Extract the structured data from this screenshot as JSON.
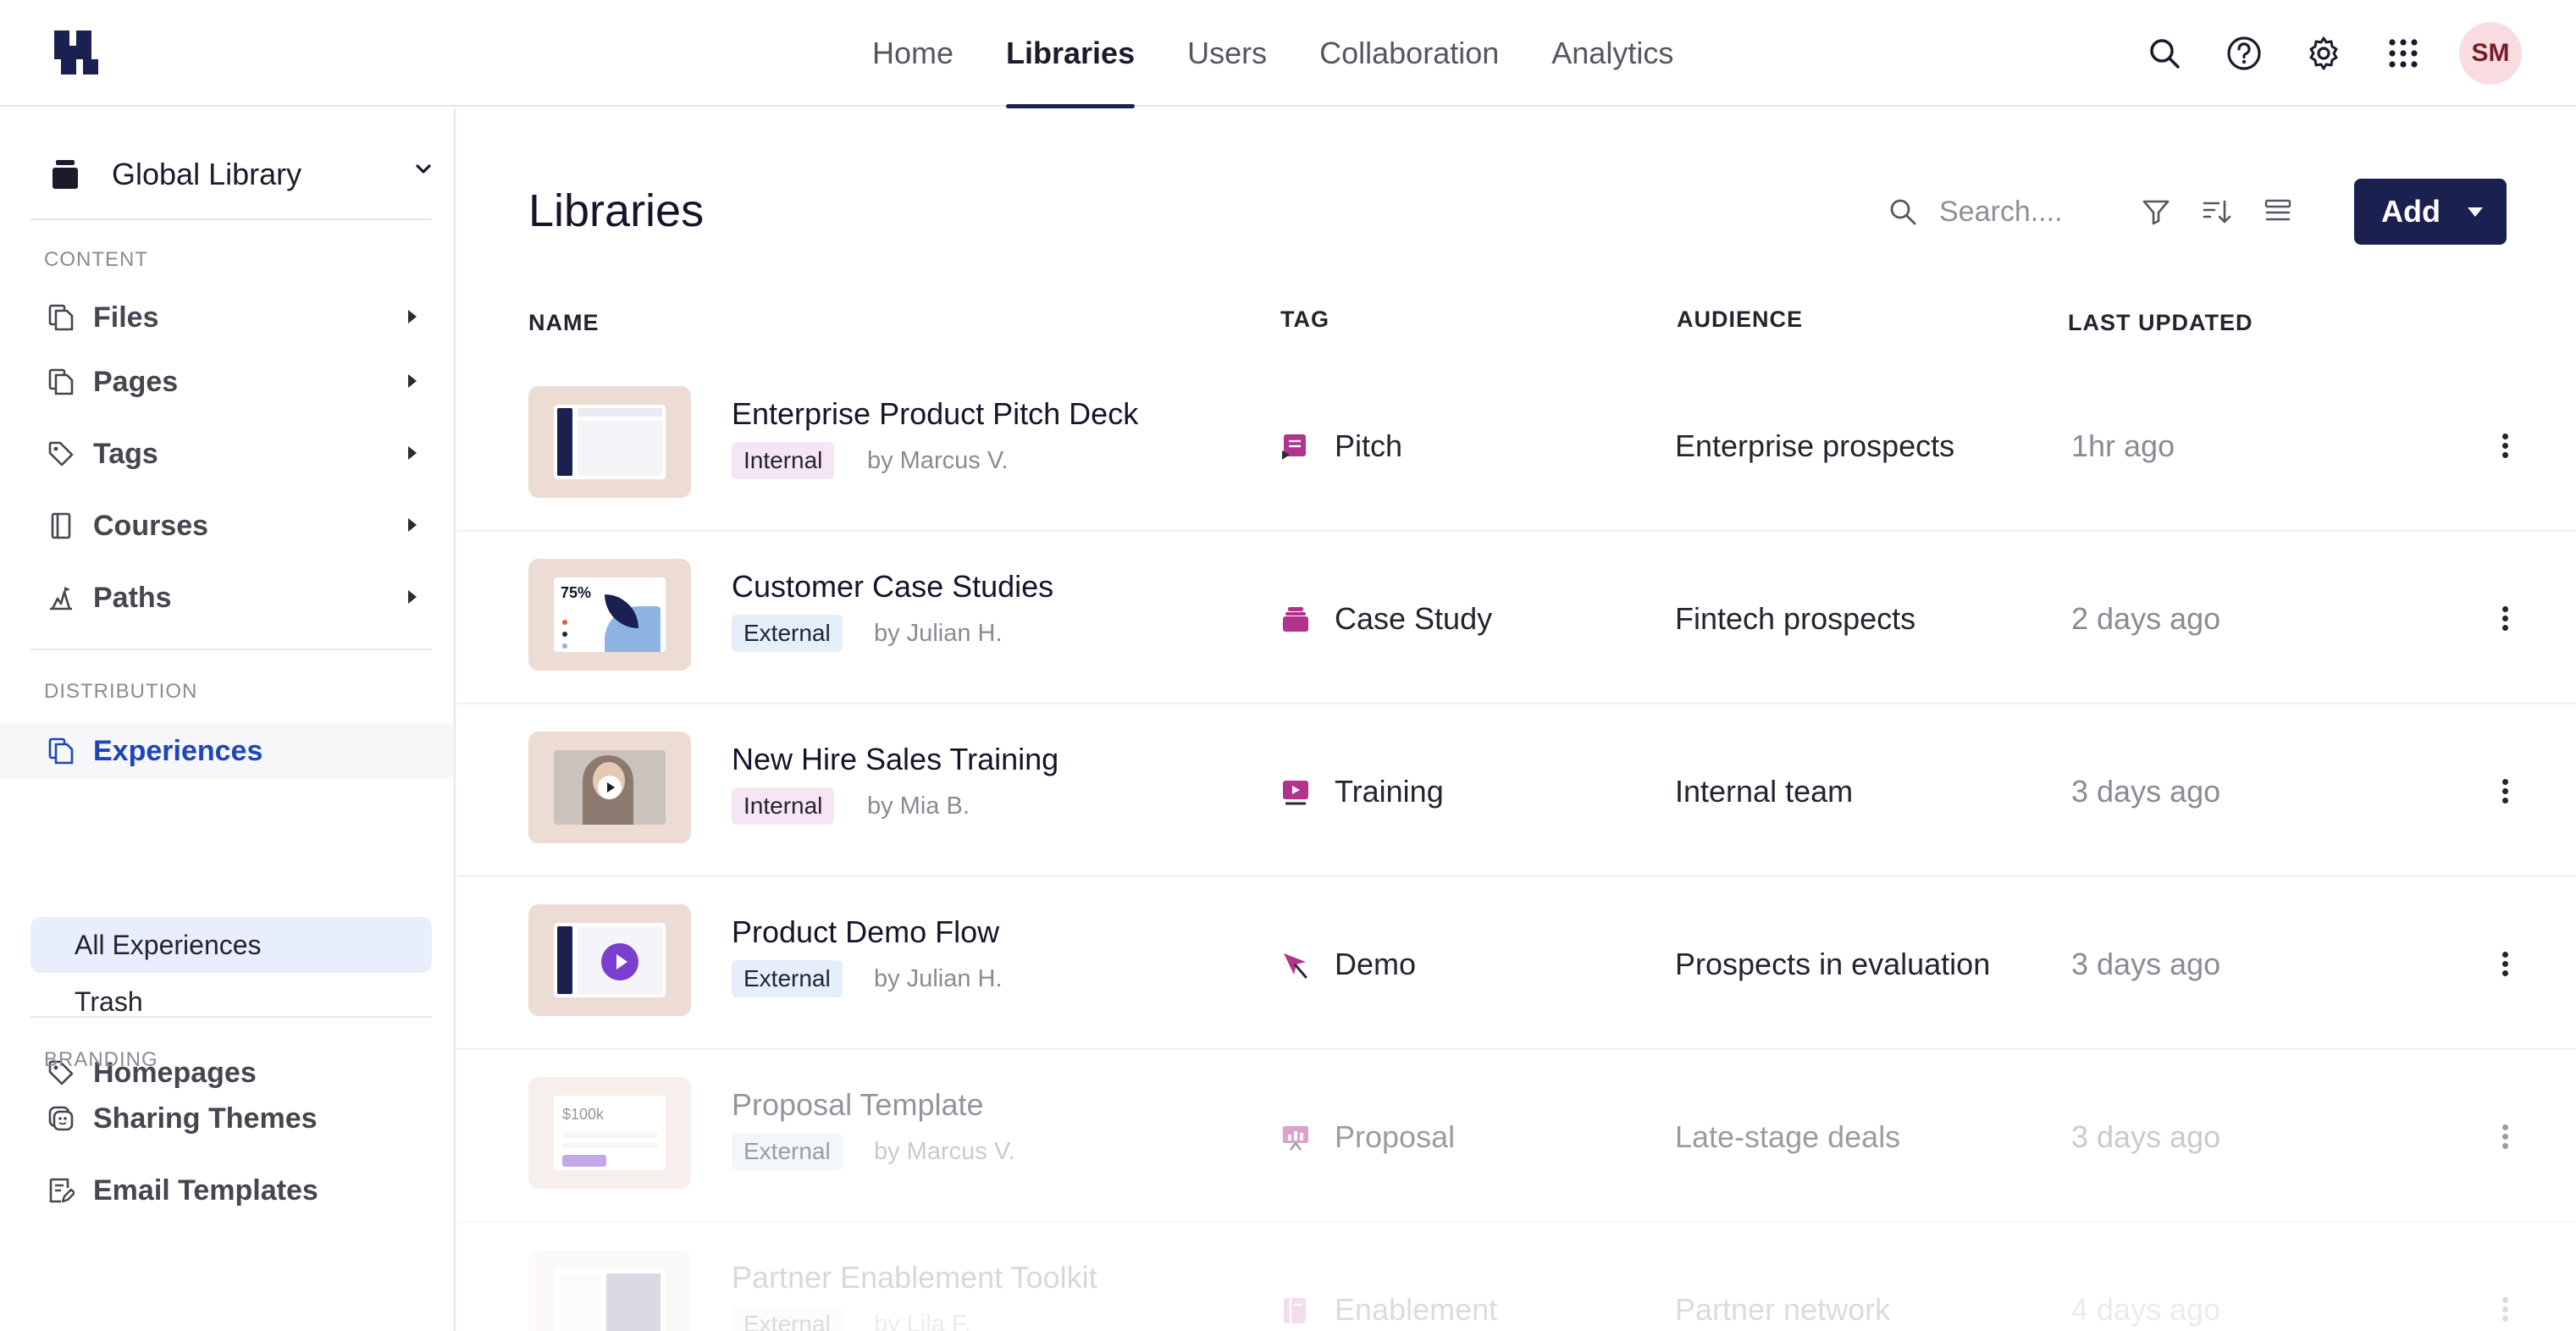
{
  "topnav": {
    "items": [
      {
        "label": "Home"
      },
      {
        "label": "Libraries"
      },
      {
        "label": "Users"
      },
      {
        "label": "Collaboration"
      },
      {
        "label": "Analytics"
      }
    ],
    "active": "Libraries",
    "avatar_initials": "SM"
  },
  "sidebar": {
    "library_selector": "Global Library",
    "sections": {
      "content": "CONTENT",
      "distribution": "DISTRIBUTION",
      "branding": "BRANDING"
    },
    "content_items": [
      {
        "label": "Files",
        "icon": "files-icon"
      },
      {
        "label": "Pages",
        "icon": "pages-icon"
      },
      {
        "label": "Tags",
        "icon": "tag-icon"
      },
      {
        "label": "Courses",
        "icon": "book-icon"
      },
      {
        "label": "Paths",
        "icon": "paths-icon"
      }
    ],
    "experiences": "Experiences",
    "experiences_sub": [
      "All Experiences",
      "Trash"
    ],
    "homepages": "Homepages",
    "branding_items": [
      {
        "label": "Sharing Themes",
        "icon": "palette-icon"
      },
      {
        "label": "Email Templates",
        "icon": "email-template-icon"
      }
    ]
  },
  "main": {
    "title": "Libraries",
    "search_placeholder": "Search....",
    "add_label": "Add",
    "columns": {
      "name": "NAME",
      "tag": "TAG",
      "audience": "AUDIENCE",
      "updated": "LAST UPDATED"
    },
    "rows": [
      {
        "title": "Enterprise Product Pitch Deck",
        "visibility": "Internal",
        "author": "by Marcus V.",
        "tag": "Pitch",
        "audience": "Enterprise prospects",
        "updated": "1hr ago"
      },
      {
        "title": "Customer Case Studies",
        "visibility": "External",
        "author": "by Julian H.",
        "tag": "Case Study",
        "audience": "Fintech prospects",
        "updated": "2 days ago",
        "thumb_text": "75%"
      },
      {
        "title": "New Hire Sales Training",
        "visibility": "Internal",
        "author": "by Mia B.",
        "tag": "Training",
        "audience": "Internal team",
        "updated": "3 days ago"
      },
      {
        "title": "Product Demo Flow",
        "visibility": "External",
        "author": "by Julian H.",
        "tag": "Demo",
        "audience": "Prospects in evaluation",
        "updated": "3 days ago"
      },
      {
        "title": "Proposal Template",
        "visibility": "External",
        "author": "by Marcus V.",
        "tag": "Proposal",
        "audience": "Late-stage deals",
        "updated": "3 days ago",
        "thumb_text": "$100k"
      },
      {
        "title": "Partner Enablement Toolkit",
        "visibility": "External",
        "author": "by Lila F.",
        "tag": "Enablement",
        "audience": "Partner network",
        "updated": "4 days ago"
      }
    ]
  },
  "colors": {
    "brand_navy": "#1a2151",
    "accent_blue": "#1e46b8",
    "tag_magenta": "#b2338d",
    "internal_badge": "#f6e6f5",
    "external_badge": "#e5effa"
  }
}
